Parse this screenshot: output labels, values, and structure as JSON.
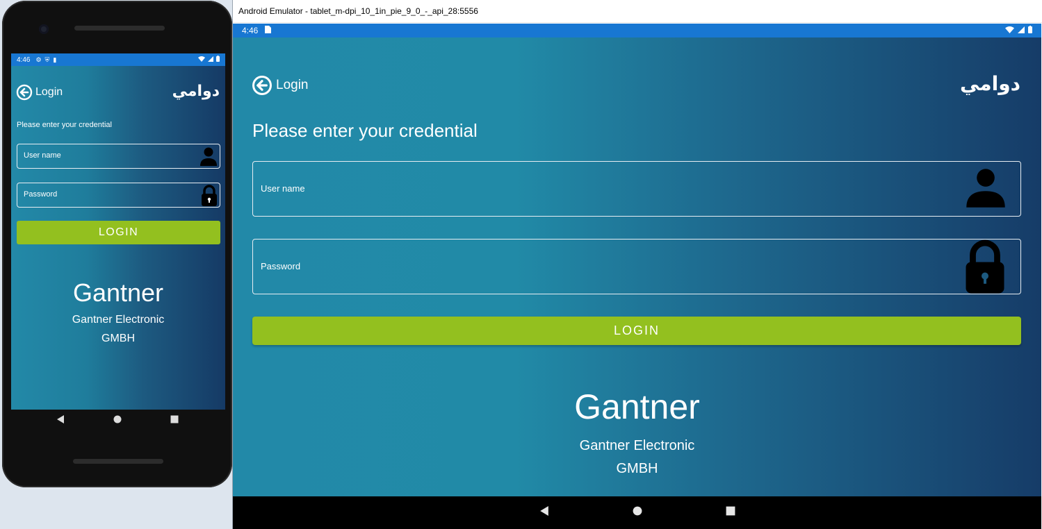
{
  "phone": {
    "status": {
      "time": "4:46"
    },
    "header": {
      "title": "Login",
      "logo": "دوامي"
    },
    "prompt": "Please enter your credential",
    "fields": {
      "username_label": "User name",
      "password_label": "Password"
    },
    "login_button": "LOGIN",
    "company": {
      "name": "Gantner",
      "line1": "Gantner Electronic",
      "line2": "GMBH"
    }
  },
  "window": {
    "title": "Android Emulator - tablet_m-dpi_10_1in_pie_9_0_-_api_28:5556"
  },
  "tablet": {
    "status": {
      "time": "4:46"
    },
    "header": {
      "title": "Login",
      "logo": "دوامي"
    },
    "prompt": "Please enter your credential",
    "fields": {
      "username_label": "User name",
      "password_label": "Password"
    },
    "login_button": "LOGIN",
    "company": {
      "name": "Gantner",
      "line1": "Gantner Electronic",
      "line2": "GMBH"
    }
  },
  "colors": {
    "status_bar": "#1877d2",
    "login_button": "#93c01f",
    "gradient_left": "#2289a8",
    "gradient_right": "#163c68"
  },
  "icons": [
    "back-arrow-circle-icon",
    "person-icon",
    "lock-icon",
    "sim-card-icon",
    "wifi-icon",
    "signal-icon",
    "battery-icon",
    "settings-icon",
    "shield-icon",
    "nav-back-icon",
    "nav-home-icon",
    "nav-recents-icon"
  ]
}
